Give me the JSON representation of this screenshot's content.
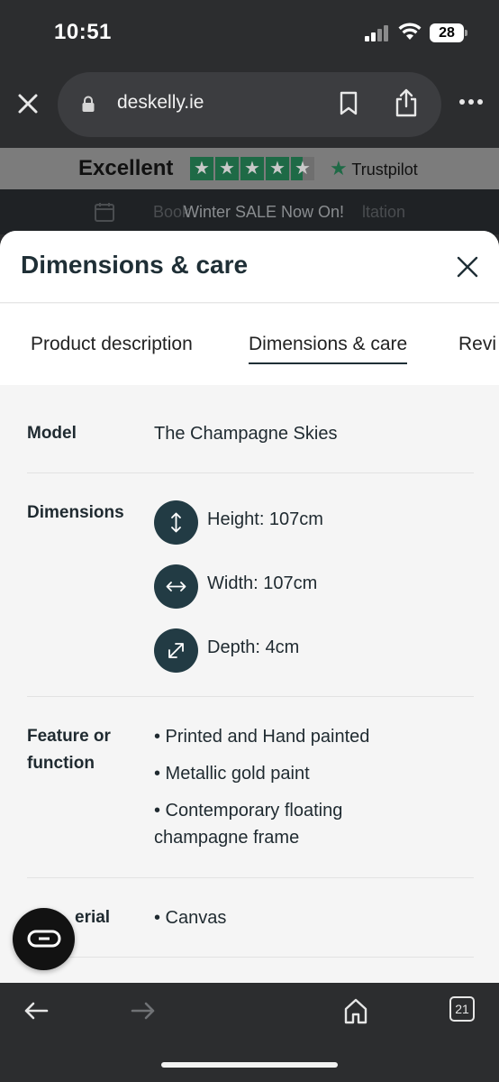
{
  "status": {
    "time": "10:51",
    "battery": "28"
  },
  "browser": {
    "url": "deskelly.ie"
  },
  "trust": {
    "rating_text": "Excellent",
    "brand": "Trustpilot",
    "star_glyph": "★"
  },
  "promo": {
    "ghost_text": "Book",
    "text": "Winter SALE Now On!",
    "ghost_text_2": "ltation"
  },
  "sheet": {
    "title": "Dimensions & care",
    "tabs": [
      {
        "label": "Product description"
      },
      {
        "label": "Dimensions & care"
      },
      {
        "label": "Revi"
      }
    ],
    "model": {
      "label": "Model",
      "value": "The Champagne Skies"
    },
    "dimensions": {
      "label": "Dimensions",
      "items": [
        {
          "icon": "height-arrows-icon",
          "text": "Height: 107cm"
        },
        {
          "icon": "width-arrows-icon",
          "text": "Width: 107cm"
        },
        {
          "icon": "depth-arrows-icon",
          "text": "Depth: 4cm"
        }
      ]
    },
    "feature": {
      "label": "Feature or function",
      "items": [
        "• Printed and Hand painted",
        "• Metallic gold paint",
        "• Contemporary floating champagne frame"
      ]
    },
    "material": {
      "label": "erial",
      "items": [
        "• Canvas"
      ]
    }
  },
  "toolbar": {
    "tabs_count": "21"
  },
  "colors": {
    "accent": "#223b44",
    "trustpilot_green": "#1e6a46"
  }
}
